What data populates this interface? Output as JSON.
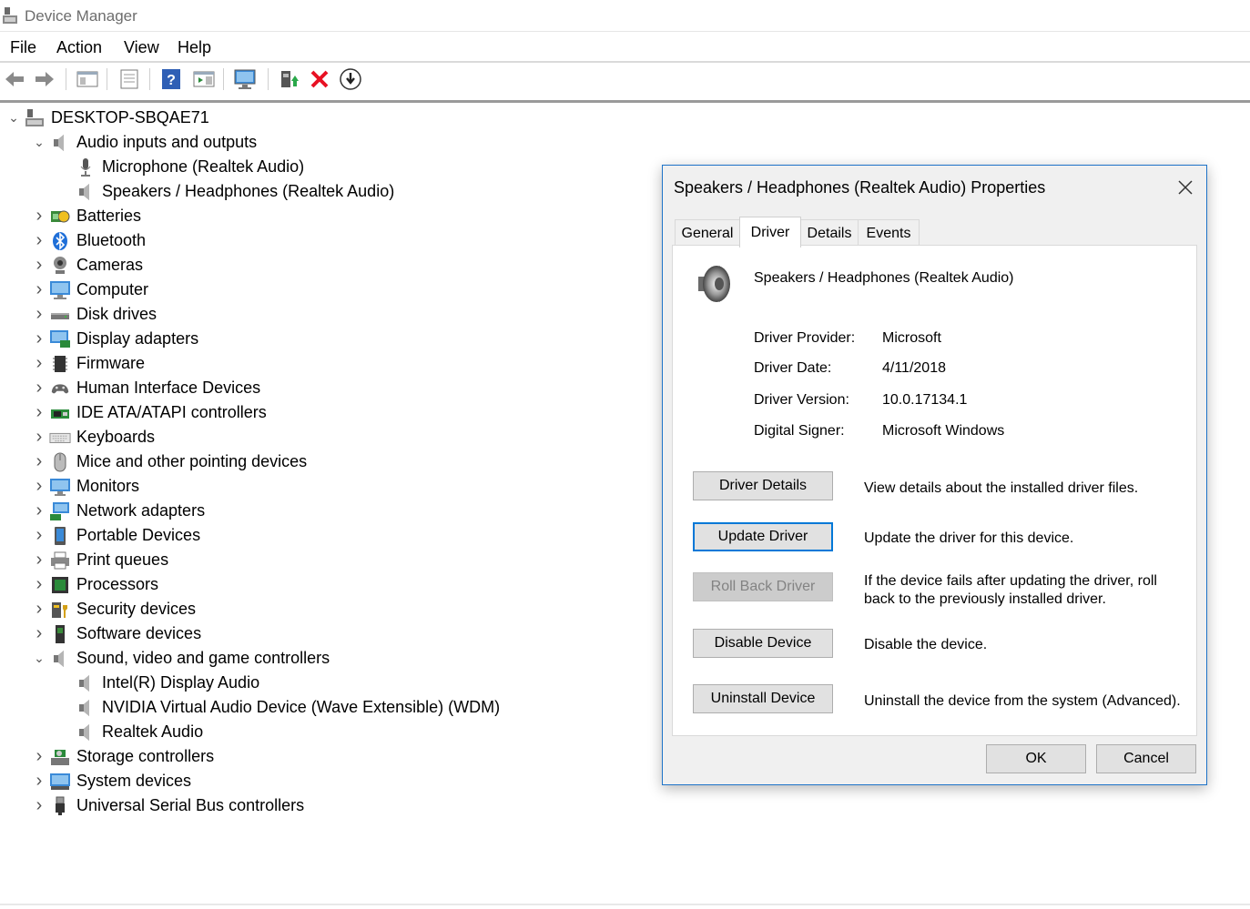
{
  "app": {
    "title": "Device Manager"
  },
  "menu": [
    "File",
    "Action",
    "View",
    "Help"
  ],
  "toolbar_icons": [
    "back-arrow-icon",
    "forward-arrow-icon",
    "show-hide-tree-icon",
    "properties-icon",
    "help-icon",
    "action-pane-icon",
    "scan-hardware-icon",
    "update-driver-icon",
    "uninstall-icon",
    "disable-device-icon"
  ],
  "tree": {
    "root": "DESKTOP-SBQAE71",
    "rows": [
      {
        "label": "Audio inputs and outputs",
        "level": 1,
        "expanded": true,
        "icon": "speaker-icon"
      },
      {
        "label": "Microphone (Realtek Audio)",
        "level": 2,
        "icon": "microphone-icon"
      },
      {
        "label": "Speakers / Headphones (Realtek Audio)",
        "level": 2,
        "icon": "speaker-icon"
      },
      {
        "label": "Batteries",
        "level": 1,
        "icon": "battery-icon"
      },
      {
        "label": "Bluetooth",
        "level": 1,
        "icon": "bluetooth-icon"
      },
      {
        "label": "Cameras",
        "level": 1,
        "icon": "camera-icon"
      },
      {
        "label": "Computer",
        "level": 1,
        "icon": "computer-icon"
      },
      {
        "label": "Disk drives",
        "level": 1,
        "icon": "disk-icon"
      },
      {
        "label": "Display adapters",
        "level": 1,
        "icon": "display-adapter-icon"
      },
      {
        "label": "Firmware",
        "level": 1,
        "icon": "firmware-icon"
      },
      {
        "label": "Human Interface Devices",
        "level": 1,
        "icon": "hid-icon"
      },
      {
        "label": "IDE ATA/ATAPI controllers",
        "level": 1,
        "icon": "ide-icon"
      },
      {
        "label": "Keyboards",
        "level": 1,
        "icon": "keyboard-icon"
      },
      {
        "label": "Mice and other pointing devices",
        "level": 1,
        "icon": "mouse-icon"
      },
      {
        "label": "Monitors",
        "level": 1,
        "icon": "monitor-icon"
      },
      {
        "label": "Network adapters",
        "level": 1,
        "icon": "network-icon"
      },
      {
        "label": "Portable Devices",
        "level": 1,
        "icon": "portable-device-icon"
      },
      {
        "label": "Print queues",
        "level": 1,
        "icon": "printer-icon"
      },
      {
        "label": "Processors",
        "level": 1,
        "icon": "processor-icon"
      },
      {
        "label": "Security devices",
        "level": 1,
        "icon": "security-icon"
      },
      {
        "label": "Software devices",
        "level": 1,
        "icon": "software-device-icon"
      },
      {
        "label": "Sound, video and game controllers",
        "level": 1,
        "expanded": true,
        "icon": "speaker-icon"
      },
      {
        "label": "Intel(R) Display Audio",
        "level": 2,
        "icon": "speaker-icon"
      },
      {
        "label": "NVIDIA Virtual Audio Device (Wave Extensible) (WDM)",
        "level": 2,
        "icon": "speaker-icon"
      },
      {
        "label": "Realtek Audio",
        "level": 2,
        "icon": "speaker-icon"
      },
      {
        "label": "Storage controllers",
        "level": 1,
        "icon": "storage-icon"
      },
      {
        "label": "System devices",
        "level": 1,
        "icon": "system-icon"
      },
      {
        "label": "Universal Serial Bus controllers",
        "level": 1,
        "icon": "usb-icon"
      }
    ]
  },
  "dialog": {
    "title": "Speakers / Headphones (Realtek Audio) Properties",
    "tabs": [
      "General",
      "Driver",
      "Details",
      "Events"
    ],
    "active_tab": "Driver",
    "device_name": "Speakers / Headphones (Realtek Audio)",
    "properties": [
      {
        "label": "Driver Provider:",
        "value": "Microsoft"
      },
      {
        "label": "Driver Date:",
        "value": "4/11/2018"
      },
      {
        "label": "Driver Version:",
        "value": "10.0.17134.1"
      },
      {
        "label": "Digital Signer:",
        "value": "Microsoft Windows"
      }
    ],
    "actions": [
      {
        "label": "Driver Details",
        "desc": "View details about the installed driver files.",
        "state": "normal"
      },
      {
        "label": "Update Driver",
        "desc": "Update the driver for this device.",
        "state": "focused"
      },
      {
        "label": "Roll Back Driver",
        "desc": "If the device fails after updating the driver, roll back to the previously installed driver.",
        "state": "disabled"
      },
      {
        "label": "Disable Device",
        "desc": "Disable the device.",
        "state": "normal"
      },
      {
        "label": "Uninstall Device",
        "desc": "Uninstall the device from the system (Advanced).",
        "state": "normal"
      }
    ],
    "ok_label": "OK",
    "cancel_label": "Cancel"
  },
  "colors": {
    "accent": "#0078d7",
    "dialog_border": "#1e73c8",
    "delete_red": "#e81123"
  }
}
